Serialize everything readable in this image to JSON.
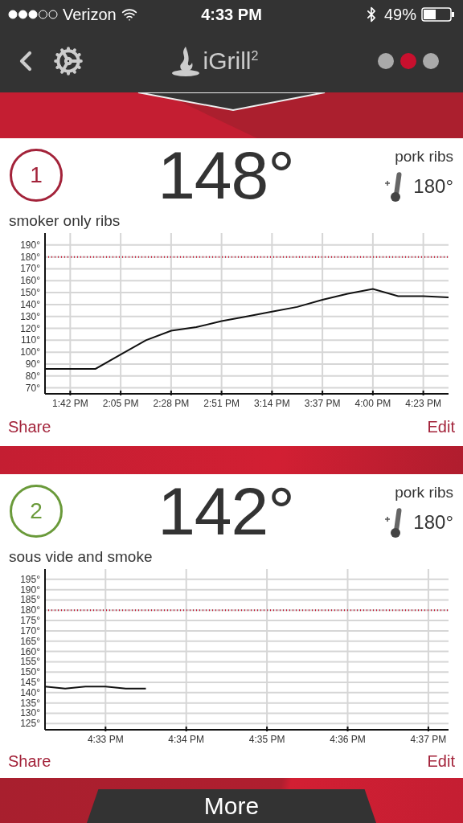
{
  "status_bar": {
    "carrier": "Verizon",
    "time": "4:33 PM",
    "battery": "49%"
  },
  "nav": {
    "logo": "iGrill$^{2}$",
    "pages": [
      {
        "selected": false
      },
      {
        "selected": true
      },
      {
        "selected": false
      }
    ]
  },
  "probes": [
    {
      "number": "1",
      "color": "#a3233a",
      "temperature": "148°",
      "food": "pork ribs",
      "target": "180°",
      "title": "smoker only ribs",
      "actions": [
        "Share",
        "Edit"
      ],
      "chart_data": {
        "type": "line",
        "categories": [
          null,
          "1:42 PM",
          null,
          "2:05 PM",
          null,
          "2:28 PM",
          null,
          "2:51 PM",
          null,
          "3:14 PM",
          null,
          "3:37 PM",
          null,
          "4:00 PM",
          null,
          "4:23 PM",
          null
        ],
        "series": [
          {
            "color": "#111111",
            "values": [
              86,
              86,
              86,
              98,
              110,
              118,
              121,
              126,
              130,
              134,
              138,
              144,
              149,
              153,
              147,
              147,
              146
            ]
          }
        ],
        "ylim": [
          65,
          200
        ],
        "grid": true,
        "yticks": [
          {
            "value": 70,
            "label": "70°"
          },
          {
            "value": 80,
            "label": "80°"
          },
          {
            "value": 90,
            "label": "90°"
          },
          {
            "value": 100,
            "label": "100°"
          },
          {
            "value": 110,
            "label": "110°"
          },
          {
            "value": 120,
            "label": "120°"
          },
          {
            "value": 130,
            "label": "130°"
          },
          {
            "value": 140,
            "label": "140°"
          },
          {
            "value": 150,
            "label": "150°"
          },
          {
            "value": 160,
            "label": "160°"
          },
          {
            "value": 170,
            "label": "170°"
          },
          {
            "value": 180,
            "label": "180°"
          },
          {
            "value": 190,
            "label": "190°"
          }
        ],
        "ref_lines": [
          {
            "axis": "y",
            "value": 180,
            "color": "#c8102e"
          }
        ]
      }
    },
    {
      "number": "2",
      "color": "#6a9a3a",
      "temperature": "142°",
      "food": "pork ribs",
      "target": "180°",
      "title": "sous vide and smoke",
      "actions": [
        "Share",
        "Edit"
      ],
      "chart_data": {
        "type": "line",
        "categories": [
          null,
          null,
          null,
          "4:33 PM",
          null,
          null,
          null,
          "4:34 PM",
          null,
          null,
          null,
          "4:35 PM",
          null,
          null,
          null,
          "4:36 PM",
          null,
          null,
          null,
          "4:37 PM",
          null
        ],
        "series": [
          {
            "color": "#111111",
            "values": [
              143,
              142,
              143,
              143,
              142,
              142,
              null,
              null,
              null,
              null,
              null,
              null,
              null,
              null,
              null,
              null,
              null,
              null,
              null,
              null,
              null
            ]
          }
        ],
        "ylim": [
          122,
          200
        ],
        "grid": true,
        "yticks": [
          {
            "value": 125,
            "label": "125°"
          },
          {
            "value": 130,
            "label": "130°"
          },
          {
            "value": 135,
            "label": "135°"
          },
          {
            "value": 140,
            "label": "140°"
          },
          {
            "value": 145,
            "label": "145°"
          },
          {
            "value": 150,
            "label": "150°"
          },
          {
            "value": 155,
            "label": "155°"
          },
          {
            "value": 160,
            "label": "160°"
          },
          {
            "value": 165,
            "label": "165°"
          },
          {
            "value": 170,
            "label": "170°"
          },
          {
            "value": 175,
            "label": "175°"
          },
          {
            "value": 180,
            "label": "180°"
          },
          {
            "value": 185,
            "label": "185°"
          },
          {
            "value": 190,
            "label": "190°"
          },
          {
            "value": 195,
            "label": "195°"
          }
        ],
        "ref_lines": [
          {
            "axis": "y",
            "value": 180,
            "color": "#c8102e"
          }
        ]
      }
    }
  ],
  "more_button": "More"
}
